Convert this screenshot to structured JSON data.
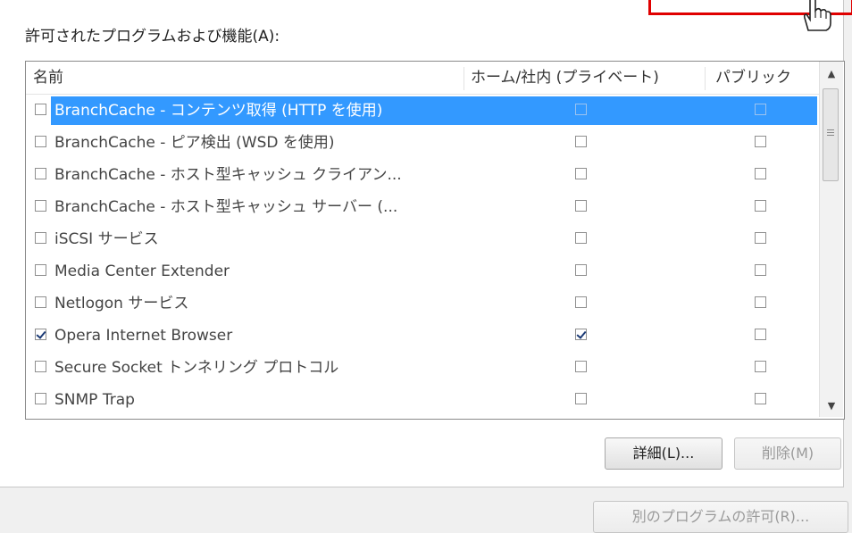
{
  "section_label": "許可されたプログラムおよび機能(A):",
  "columns": {
    "name": "名前",
    "private": "ホーム/社内 (プライベート)",
    "public": "パブリック"
  },
  "rows": [
    {
      "label": "BranchCache - コンテンツ取得 (HTTP を使用)",
      "enabled": false,
      "private": false,
      "public": false,
      "selected": true
    },
    {
      "label": "BranchCache - ピア検出 (WSD を使用)",
      "enabled": false,
      "private": false,
      "public": false,
      "selected": false
    },
    {
      "label": "BranchCache - ホスト型キャッシュ クライアン...",
      "enabled": false,
      "private": false,
      "public": false,
      "selected": false
    },
    {
      "label": "BranchCache - ホスト型キャッシュ サーバー (...",
      "enabled": false,
      "private": false,
      "public": false,
      "selected": false
    },
    {
      "label": "iSCSI サービス",
      "enabled": false,
      "private": false,
      "public": false,
      "selected": false
    },
    {
      "label": "Media Center Extender",
      "enabled": false,
      "private": false,
      "public": false,
      "selected": false
    },
    {
      "label": "Netlogon サービス",
      "enabled": false,
      "private": false,
      "public": false,
      "selected": false
    },
    {
      "label": "Opera Internet Browser",
      "enabled": true,
      "private": true,
      "public": false,
      "selected": false
    },
    {
      "label": "Secure Socket トンネリング プロトコル",
      "enabled": false,
      "private": false,
      "public": false,
      "selected": false
    },
    {
      "label": "SNMP Trap",
      "enabled": false,
      "private": false,
      "public": false,
      "selected": false
    }
  ],
  "buttons": {
    "details": "詳細(L)...",
    "remove": "削除(M)",
    "allow_other": "別のプログラムの許可(R)..."
  },
  "colors": {
    "selection": "#3399ff",
    "highlight_box": "#e00000"
  },
  "icons": {
    "cursor": "hand-pointer-icon",
    "scroll_up": "scroll-up-arrow-icon",
    "scroll_down": "scroll-down-arrow-icon"
  }
}
